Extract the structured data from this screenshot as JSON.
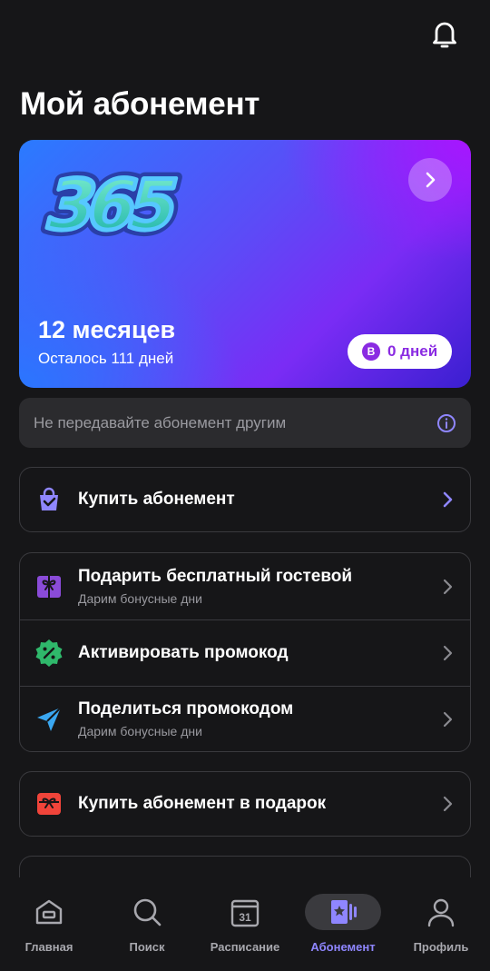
{
  "header": {
    "title": "Мой абонемент",
    "bell_icon": "bell-icon"
  },
  "card": {
    "logo_text": "365",
    "duration": "12 месяцев",
    "remaining": "Осталось 111 дней",
    "badge_letter": "B",
    "bonus_days": "0 дней",
    "colors": {
      "gradient_start": "#2a7bff",
      "gradient_end": "#7a2cf5"
    }
  },
  "notice": {
    "text": "Не передавайте абонемент другим",
    "icon": "info-icon"
  },
  "buy": {
    "title": "Купить абонемент",
    "icon": "shopping-bag-icon"
  },
  "actions": [
    {
      "title": "Подарить бесплатный гостевой",
      "subtitle": "Дарим бонусные дни",
      "icon": "gift-icon"
    },
    {
      "title": "Активировать промокод",
      "subtitle": "",
      "icon": "percent-badge-icon"
    },
    {
      "title": "Поделиться промокодом",
      "subtitle": "Дарим бонусные дни",
      "icon": "send-icon"
    }
  ],
  "gift_sub": {
    "title": "Купить абонемент в подарок",
    "icon": "gift-box-icon"
  },
  "tabs": [
    {
      "label": "Главная",
      "icon": "home-icon",
      "active": false
    },
    {
      "label": "Поиск",
      "icon": "search-icon",
      "active": false
    },
    {
      "label": "Расписание",
      "icon": "calendar-icon",
      "calendar_day": "31",
      "active": false
    },
    {
      "label": "Абонемент",
      "icon": "membership-card-icon",
      "active": true
    },
    {
      "label": "Профиль",
      "icon": "profile-icon",
      "active": false
    }
  ],
  "accent_color": "#8f86ff"
}
